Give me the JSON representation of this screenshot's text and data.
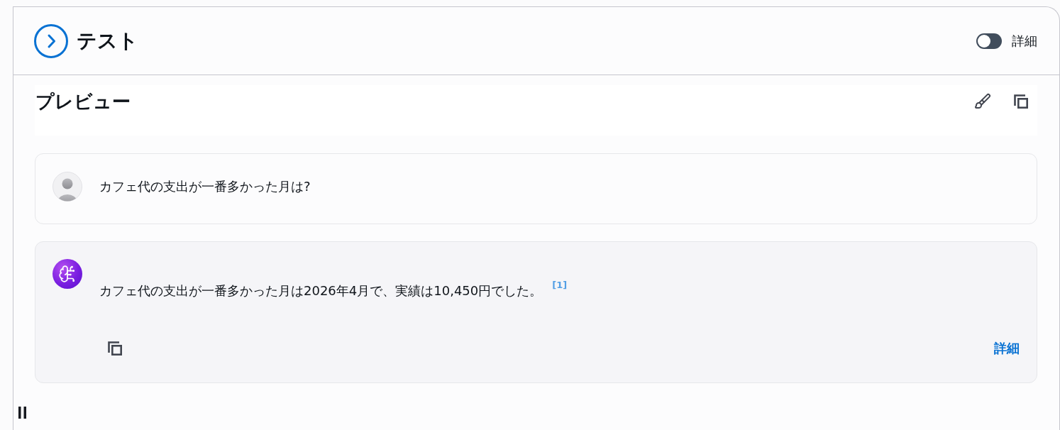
{
  "header": {
    "title": "テスト",
    "toggle": {
      "label": "詳細",
      "on": false
    }
  },
  "preview": {
    "title": "プレビュー"
  },
  "messages": [
    {
      "kind": "user",
      "text": "カフェ代の支出が一番多かった月は?"
    },
    {
      "kind": "assistant",
      "text": "カフェ代の支出が一番多かった月は2026年4月で、実績は10,450円でした。",
      "citation": "[1]",
      "details_link": "詳細"
    }
  ]
}
